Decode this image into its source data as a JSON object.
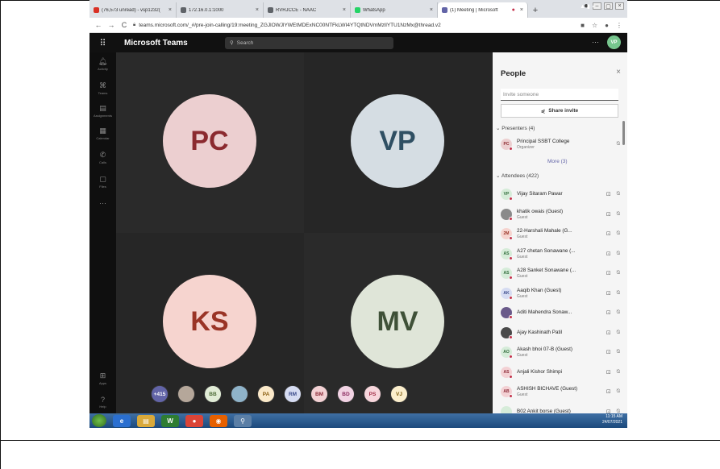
{
  "browser": {
    "tabs": [
      {
        "label": "(76,573 unread) - vsp1232(",
        "color": "#d93025"
      },
      {
        "label": "172.16.0.1:1000",
        "color": "#5f6368"
      },
      {
        "label": "RVRJCCE - NAAC",
        "color": "#5f6368"
      },
      {
        "label": "WhatsApp",
        "color": "#25d366"
      },
      {
        "label": "(1) Meeting | Microsoft",
        "color": "#6264a7"
      }
    ],
    "url": "teams.microsoft.com/_#/pre-join-calling/19:meeting_ZGJlOWJlYWEtMDExNC00NTFkLWI4YTQtNDVmMzllYTU1NzMx@thread.v2"
  },
  "teams": {
    "title": "Microsoft Teams",
    "search_placeholder": "Search",
    "more": "···",
    "me_initials": "VP"
  },
  "rail": [
    {
      "icon": "bell-icon",
      "label": "Activity",
      "glyph": "🔔︎"
    },
    {
      "icon": "teams-icon",
      "label": "Teams",
      "glyph": "⌘"
    },
    {
      "icon": "assignments-icon",
      "label": "Assignments",
      "glyph": "▤"
    },
    {
      "icon": "calendar-icon",
      "label": "Calendar",
      "glyph": "▦"
    },
    {
      "icon": "calls-icon",
      "label": "Calls",
      "glyph": "✆"
    },
    {
      "icon": "files-icon",
      "label": "Files",
      "glyph": "▢"
    },
    {
      "icon": "more-icon",
      "label": "",
      "glyph": "···"
    },
    {
      "icon": "apps-icon",
      "label": "Apps",
      "glyph": "⊞"
    },
    {
      "icon": "help-icon",
      "label": "Help",
      "glyph": "?"
    }
  ],
  "tiles": [
    {
      "initials": "PC",
      "bg": "#eccfd0",
      "fg": "#8b2a2f"
    },
    {
      "initials": "VP",
      "bg": "#d5dde3",
      "fg": "#2f4f63"
    },
    {
      "initials": "KS",
      "bg": "#f6d4cf",
      "fg": "#9a3426"
    },
    {
      "initials": "MV",
      "bg": "#dfe5d8",
      "fg": "#3f5138"
    }
  ],
  "strip": [
    {
      "label": "+415",
      "bg": "#6264a7",
      "fg": "#ffffff"
    },
    {
      "label": "",
      "bg": "#b5a79a",
      "fg": "#333"
    },
    {
      "label": "BB",
      "bg": "#e1ecd6",
      "fg": "#4b6a35"
    },
    {
      "label": "",
      "bg": "#8fb3c9",
      "fg": "#333"
    },
    {
      "label": "PA",
      "bg": "#fbe9c9",
      "fg": "#8a5d10"
    },
    {
      "label": "RM",
      "bg": "#d6dcf2",
      "fg": "#3a4a8a"
    },
    {
      "label": "BM",
      "bg": "#f3d1d4",
      "fg": "#8b2a37"
    },
    {
      "label": "BD",
      "bg": "#f2d3e4",
      "fg": "#8b2a60"
    },
    {
      "label": "PS",
      "bg": "#f7d6dc",
      "fg": "#a12b45"
    },
    {
      "label": "VJ",
      "bg": "#fbeecc",
      "fg": "#7d5a0c"
    }
  ],
  "people": {
    "title": "People",
    "invite_placeholder": "Invite someone",
    "share_label": "Share invite",
    "presenters_header": "Presenters (4)",
    "attendees_header": "Attendees (422)",
    "more_label": "More (3)",
    "presenters": [
      {
        "initials": "PC",
        "name": "Principal SSBT College",
        "role": "Organizer",
        "bg": "#eccfd0",
        "fg": "#8b2a2f"
      }
    ],
    "attendees": [
      {
        "initials": "VP",
        "name": "Vijay Sitaram Pawar",
        "role": "",
        "bg": "#d6ecd9",
        "fg": "#2f6b3a"
      },
      {
        "initials": "",
        "name": "khatik owais (Guest)",
        "role": "Guest",
        "bg": "#8a8a8a",
        "fg": "#fff"
      },
      {
        "initials": "2M",
        "name": "22-Harshali Mahale (G...",
        "role": "Guest",
        "bg": "#f6d4cf",
        "fg": "#9a3426"
      },
      {
        "initials": "AS",
        "name": "A27 chetan Sonawane (...",
        "role": "Guest",
        "bg": "#d6ecd9",
        "fg": "#2f6b3a"
      },
      {
        "initials": "AS",
        "name": "A28 Sanket Sonawane (...",
        "role": "Guest",
        "bg": "#d6ecd9",
        "fg": "#2f6b3a"
      },
      {
        "initials": "AK",
        "name": "Aaqib Khan (Guest)",
        "role": "Guest",
        "bg": "#d6dcf2",
        "fg": "#3a4a8a"
      },
      {
        "initials": "",
        "name": "Aditi Mahendra Sonaw...",
        "role": "",
        "bg": "#6a5a8a",
        "fg": "#fff"
      },
      {
        "initials": "",
        "name": "Ajay Kashinath Patil",
        "role": "",
        "bg": "#4a4a4a",
        "fg": "#fff"
      },
      {
        "initials": "AO",
        "name": "Akash bhoi 07-B (Guest)",
        "role": "Guest",
        "bg": "#d6ecd9",
        "fg": "#2f6b3a"
      },
      {
        "initials": "AS",
        "name": "Anjali Kishor Shimpi",
        "role": "",
        "bg": "#f3d1d4",
        "fg": "#8b2a37"
      },
      {
        "initials": "AB",
        "name": "ASHISH BICHAVE (Guest)",
        "role": "Guest",
        "bg": "#f3d1d4",
        "fg": "#8b2a37"
      },
      {
        "initials": "",
        "name": "B02 Ankit borse (Guest)",
        "role": "",
        "bg": "#d6ecd9",
        "fg": "#2f6b3a"
      }
    ]
  },
  "taskbar": {
    "apps": [
      {
        "icon": "ie-icon",
        "glyph": "e",
        "bg": "#2a6fd0"
      },
      {
        "icon": "explorer-icon",
        "glyph": "▤",
        "bg": "#d9a93a"
      },
      {
        "icon": "excel-icon",
        "glyph": "W",
        "bg": "#2e7d32"
      },
      {
        "icon": "chrome-icon",
        "glyph": "●",
        "bg": "#db4437"
      },
      {
        "icon": "firefox-icon",
        "glyph": "◉",
        "bg": "#e66000"
      },
      {
        "icon": "magnifier-icon",
        "glyph": "⚲",
        "bg": "#5b7fa6"
      }
    ],
    "time": "11:15 AM",
    "date": "24/07/2021"
  }
}
